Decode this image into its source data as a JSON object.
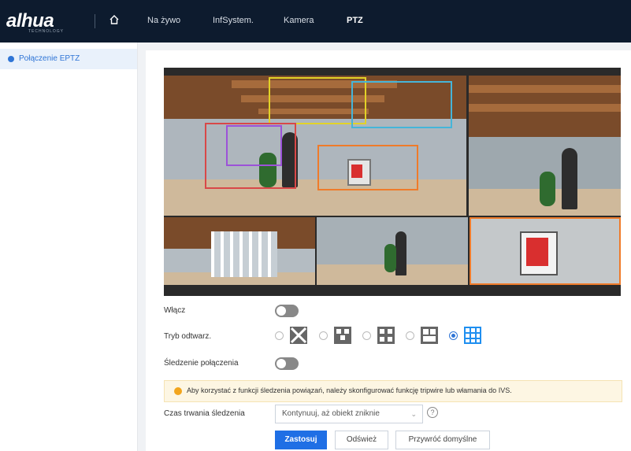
{
  "header": {
    "logo": "alhua",
    "logo_sub": "TECHNOLOGY",
    "nav": [
      "Na żywo",
      "InfSystem.",
      "Kamera",
      "PTZ"
    ],
    "active_nav": "PTZ"
  },
  "sidebar": {
    "items": [
      {
        "label": "Połączenie EPTZ"
      }
    ]
  },
  "form": {
    "enable_label": "Włącz",
    "playback_mode_label": "Tryb odtwarz.",
    "tracking_label": "Śledzenie połączenia",
    "duration_label": "Czas trwania śledzenia",
    "duration_value": "Kontynuuj, aż obiekt zniknie",
    "info_text": "Aby korzystać z funkcji śledzenia powiązań, należy skonfigurować funkcję tripwire lub włamania do IVS.",
    "help_glyph": "?"
  },
  "buttons": {
    "apply": "Zastosuj",
    "refresh": "Odśwież",
    "default": "Przywróć domyślne"
  },
  "colors": {
    "accent": "#1f6fe5",
    "topbar": "#0d1b2e",
    "warning": "#f2a51d"
  }
}
